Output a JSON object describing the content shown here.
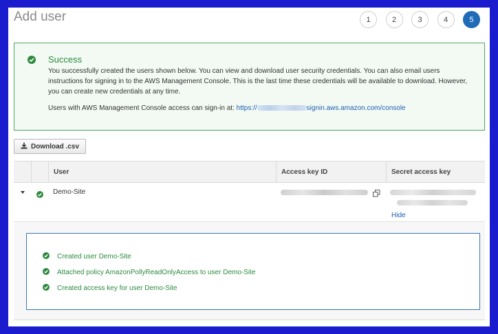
{
  "header": {
    "title": "Add user"
  },
  "steps": [
    "1",
    "2",
    "3",
    "4",
    "5"
  ],
  "success": {
    "title": "Success",
    "body": "You successfully created the users shown below. You can view and download user security credentials. You can also email users instructions for signing in to the AWS Management Console. This is the last time these credentials will be available to download. However, you can create new credentials at any time.",
    "signin_label": "Users with AWS Management Console access can sign-in at:",
    "signin_url_start": "https://",
    "signin_url_end": "signin.aws.amazon.com/console"
  },
  "download_button": "Download .csv",
  "table": {
    "headers": [
      "User",
      "Access key ID",
      "Secret access key"
    ],
    "rows": [
      {
        "user": "Demo-Site",
        "hide_label": "Hide"
      }
    ]
  },
  "details": [
    "Created user Demo-Site",
    "Attached policy AmazonPollyReadOnlyAccess to user Demo-Site",
    "Created access key for user Demo-Site"
  ],
  "colors": {
    "success_green": "#2d8a3e",
    "accent_blue": "#1f6bb8",
    "frame_border": "#1c1ccf"
  }
}
